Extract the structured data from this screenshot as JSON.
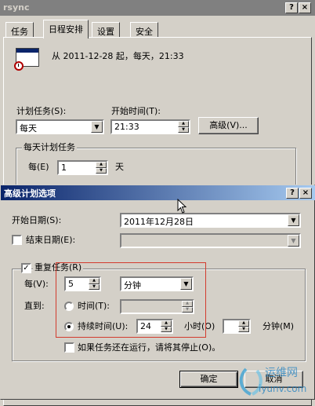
{
  "back_window": {
    "title": "rsync",
    "help_btn": "?",
    "close_btn": "×",
    "tabs": [
      {
        "label": "任务"
      },
      {
        "label": "日程安排",
        "active": true
      },
      {
        "label": "设置"
      },
      {
        "label": "安全"
      }
    ],
    "summary": "从 2011-12-28 起，每天，21:33",
    "schedule_task_label": "计划任务(S):",
    "schedule_task_value": "每天",
    "start_time_label": "开始时间(T):",
    "start_time_value": "21:33",
    "advanced_button": "高级(V)...",
    "daily_group_label": "每天计划任务",
    "every_label": "每(E)",
    "every_value": "1",
    "every_unit": "天"
  },
  "advanced_dialog": {
    "title": "高级计划选项",
    "help_btn": "?",
    "close_btn": "×",
    "start_date_label": "开始日期(S):",
    "start_date_value": "2011年12月28日",
    "end_date_label": "结束日期(E):",
    "end_date_checked": false,
    "repeat_label": "重复任务(R)",
    "repeat_checked": true,
    "every_label": "每(V):",
    "every_value": "5",
    "every_unit": "分钟",
    "until_label": "直到:",
    "time_option_label": "时间(T):",
    "duration_option_label": "持续时间(U):",
    "duration_hours_value": "24",
    "hours_label": "小时(O)",
    "minutes_value": "",
    "minutes_label": "分钟(M)",
    "stop_if_running_label": "如果任务还在运行，请将其停止(O)。",
    "stop_if_running_checked": false,
    "ok_button": "确定",
    "cancel_button": "取消"
  },
  "watermark": {
    "text_cn": "运维网",
    "text_url": "iyunv.com"
  },
  "colors": {
    "title_active": "#0a246a",
    "title_inactive": "#808080",
    "face": "#d4d0c8",
    "highlight_box": "#d23b2e"
  }
}
